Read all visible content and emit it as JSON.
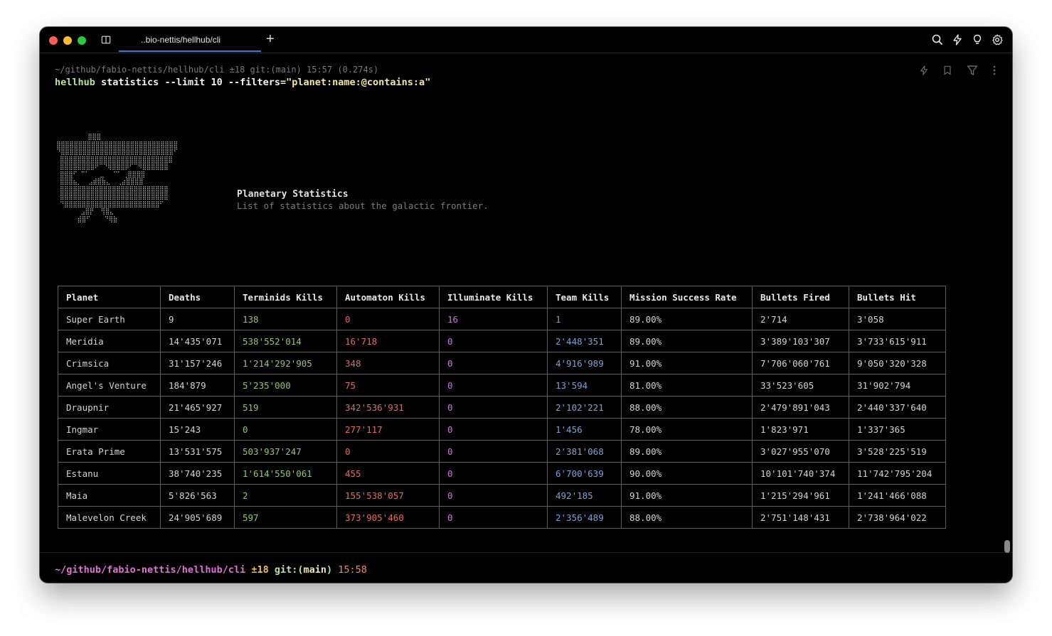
{
  "tab": {
    "title": "..bio-nettis/hellhub/cli"
  },
  "block": {
    "header": "~/github/fabio-nettis/hellhub/cli ±18 git:(main) 15:57 (0.274s)",
    "command_bin": "hellhub",
    "command_args": " statistics --limit 10 --filters=",
    "command_str": "\"planet:name:@contains:a\""
  },
  "ascii_art": "         ⣿⣿⣿\n⣿⣿⣿⣿⣿⣿⣿⣿⣿⣿⣿⣿⣿⣿⣿⣿⣿⣿⣿⣿⣿⣿⣿⣿⣿⣿⣿⣿\n⠙⣿⣿⣿⣿⣿⣿⣿⣿⣿⣿⣿⣿⣿⣿⣿⣿⣿⣿⣿⣿⣿⣿⣿⣿⣿⣿⠋\n ⣿⣿⣿⣿⣿⣿⣿⣿⣿⣿⣿⣿⣿⣿⣿⣿⣿⣿⣿⣿⣿⣿⣿⣿⣿⣿\n ⣿⣿⣿⣿⣿⣿⣿⣿⠟⠉⠙⢿⣿⣿⣿⡿⠋⠉⠻⣿⣿⣿⣿⣿⣿\n ⣿⣿⣿⠋ ⠉⠁   ⣀  ⠈⠉ ⢀⣿⣿⣿⣿\n ⣿⣿⣿⣦⡀  ⣠⣾⣿⣷⣄  ⢀⣴⣿⣿⣿⣿\n ⣿⣿⣿⣿⣿⣿⣿⣿⣿⣿⣿⣿⣿⣿⣿⣿⣿⣿⣿⣿⣿⣿⣿⣿⣿\n ⣿⣿⣿⣿⣿⣿⣿⣿⣿⣿⣿⣿⣿⣿⣿⣿⣿⣿⣿⣿⣿⣿⣿⣿⣿\n ⠙⣿⣿⣿⣿⣿⣿⣿⣿⣿⣿⣿⣿⣿⣿⣿⣿⣿⣿⣿⣿⣿⣿⠋\n       ⣠⣿⡟  ⢻⣿⣄\n      ⣾⣿⠋    ⠙⢿⣷",
  "stats": {
    "title": "Planetary Statistics",
    "subtitle": "List of statistics about the galactic frontier."
  },
  "table": {
    "headers": [
      "Planet",
      "Deaths",
      "Terminids Kills",
      "Automaton Kills",
      "Illuminate Kills",
      "Team Kills",
      "Mission Success Rate",
      "Bullets Fired",
      "Bullets Hit"
    ],
    "rows": [
      [
        "Super Earth",
        "9",
        "138",
        "0",
        "16",
        "1",
        "89.00%",
        "2'714",
        "3'058"
      ],
      [
        "Meridia",
        "14'435'071",
        "538'552'014",
        "16'718",
        "0",
        "2'448'351",
        "89.00%",
        "3'389'103'307",
        "3'733'615'911"
      ],
      [
        "Crimsica",
        "31'157'246",
        "1'214'292'905",
        "348",
        "0",
        "4'916'989",
        "91.00%",
        "7'706'060'761",
        "9'050'320'328"
      ],
      [
        "Angel's Venture",
        "184'879",
        "5'235'000",
        "75",
        "0",
        "13'594",
        "81.00%",
        "33'523'605",
        "31'902'794"
      ],
      [
        "Draupnir",
        "21'465'927",
        "519",
        "342'536'931",
        "0",
        "2'102'221",
        "88.00%",
        "2'479'891'043",
        "2'440'337'640"
      ],
      [
        "Ingmar",
        "15'243",
        "0",
        "277'117",
        "0",
        "1'456",
        "78.00%",
        "1'823'971",
        "1'337'365"
      ],
      [
        "Erata Prime",
        "13'531'575",
        "503'937'247",
        "0",
        "0",
        "2'381'068",
        "89.00%",
        "3'027'955'070",
        "3'528'225'519"
      ],
      [
        "Estanu",
        "38'740'235",
        "1'614'550'061",
        "455",
        "0",
        "6'700'639",
        "90.00%",
        "10'101'740'374",
        "11'742'795'204"
      ],
      [
        "Maia",
        "5'826'563",
        "2",
        "155'538'057",
        "0",
        "492'185",
        "91.00%",
        "1'215'294'961",
        "1'241'466'088"
      ],
      [
        "Malevelon Creek",
        "24'905'689",
        "597",
        "373'905'460",
        "0",
        "2'356'489",
        "88.00%",
        "2'751'148'431",
        "2'738'964'022"
      ]
    ]
  },
  "prompt": {
    "path": "~/github/fabio-nettis/hellhub/cli",
    "status": " ±18",
    "git": " git:(",
    "branch": "main",
    "git_close": ")",
    "time": " 15:58"
  },
  "colors": {
    "terminids": "#8fc76a",
    "automaton": "#e06c5e",
    "illuminate": "#c77ad8",
    "team": "#7aa2d6",
    "tab_underline": "#2f7fd9",
    "cursor": "#2ea3f2"
  },
  "icons": [
    "book-icon",
    "plus-icon",
    "search-icon",
    "bolt-icon",
    "lightbulb-icon",
    "gear-icon",
    "bolt-outline-icon",
    "bookmark-icon",
    "filter-icon",
    "more-vertical-icon"
  ]
}
